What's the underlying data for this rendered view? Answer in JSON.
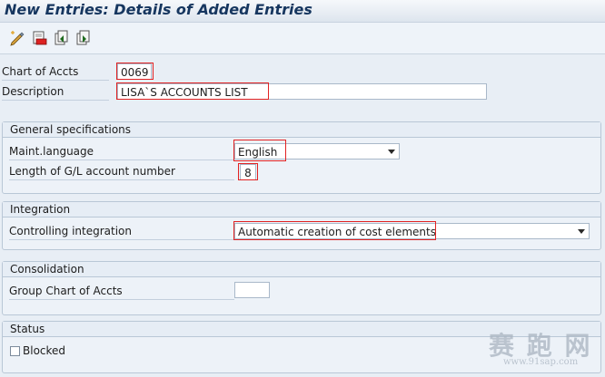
{
  "window": {
    "title": "New Entries: Details of Added Entries"
  },
  "toolbar": {
    "buttons": [
      {
        "icon": "edit-icon"
      },
      {
        "icon": "delete-icon"
      },
      {
        "icon": "previous-entry-icon"
      },
      {
        "icon": "next-entry-icon"
      }
    ]
  },
  "header": {
    "chart_label": "Chart of Accts",
    "chart_value": "0069",
    "description_label": "Description",
    "description_value": "LISA`S ACCOUNTS LIST"
  },
  "general": {
    "title": "General specifications",
    "maint_language_label": "Maint.language",
    "maint_language_value": "English",
    "length_label": "Length of G/L account number",
    "length_value": "8"
  },
  "integration": {
    "title": "Integration",
    "controlling_label": "Controlling integration",
    "controlling_value": "Automatic creation of cost elements"
  },
  "consolidation": {
    "title": "Consolidation",
    "group_chart_label": "Group Chart of Accts",
    "group_chart_value": ""
  },
  "status": {
    "title": "Status",
    "blocked_label": "Blocked",
    "blocked_checked": false
  },
  "watermark": {
    "text": "赛 跑 网",
    "url": "www.91sap.com"
  },
  "colors": {
    "highlight": "#e22222",
    "title": "#16365f",
    "background": "#e8eef5"
  }
}
